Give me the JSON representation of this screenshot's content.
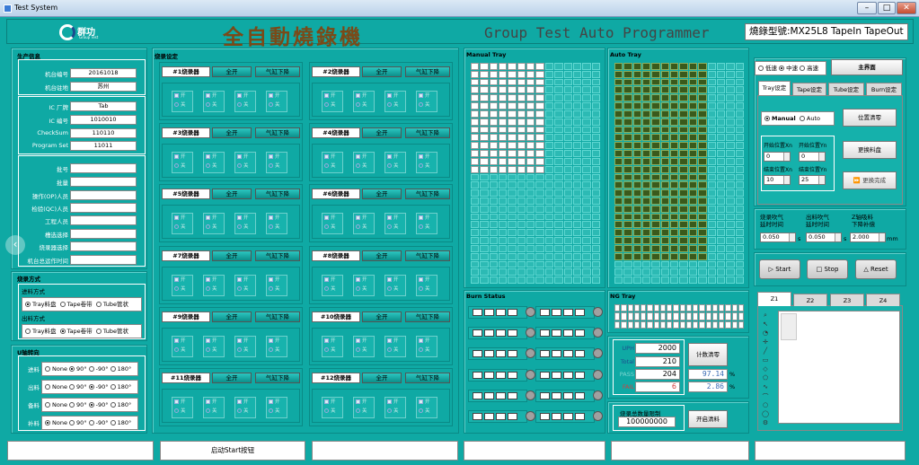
{
  "window": {
    "title": "Test System",
    "minimize": "–",
    "maximize": "□",
    "close": "✕"
  },
  "header": {
    "logo_cn": "群功",
    "logo_en": "Group Test",
    "title_cn": "全自動燒錄機",
    "title_en": "Group Test Auto Programmer",
    "model_text": "燒錄型號:MX25L8 TapeIn TapeOut"
  },
  "info": {
    "title": "生产信息",
    "rows": [
      {
        "label": "机台编号",
        "value": "20161018"
      },
      {
        "label": "机台驻地",
        "value": "苏州"
      },
      {
        "label": "IC 厂牌",
        "value": "Tab"
      },
      {
        "label": "IC 编号",
        "value": "1010010"
      },
      {
        "label": "CheckSum",
        "value": "110110"
      },
      {
        "label": "Program Set",
        "value": "11011"
      },
      {
        "label": "批号",
        "value": ""
      },
      {
        "label": "批量",
        "value": ""
      },
      {
        "label": "操作(OP)人员",
        "value": ""
      },
      {
        "label": "检验(QC)人员",
        "value": ""
      },
      {
        "label": "工程人员",
        "value": ""
      },
      {
        "label": "槽选选择",
        "value": ""
      },
      {
        "label": "烧录器选择",
        "value": ""
      },
      {
        "label": "机台总运作时间",
        "value": ""
      }
    ]
  },
  "burn_mode": {
    "title": "烧录方式",
    "in_label": "进料方式",
    "out_label": "出料方式",
    "opts": [
      "Tray料盘",
      "Tape卷带",
      "Tube管状"
    ]
  },
  "u_axis": {
    "title": "U轴转向",
    "rows": [
      {
        "label": "进料",
        "sel": 1
      },
      {
        "label": "出料",
        "sel": 2
      },
      {
        "label": "备料",
        "sel": 2
      },
      {
        "label": "补料",
        "sel": 0
      }
    ],
    "opts": [
      "None",
      "90°",
      "-90°",
      "180°"
    ]
  },
  "programmers": {
    "title": "烧录设定",
    "all_open": "全开",
    "cylinder": "气缸下降",
    "on": "开",
    "off": "关",
    "items": [
      "#1烧录器",
      "#2烧录器",
      "#3烧录器",
      "#4烧录器",
      "#5烧录器",
      "#6烧录器",
      "#7烧录器",
      "#8烧录器",
      "#9烧录器",
      "#10烧录器",
      "#11烧录器",
      "#12烧录器"
    ]
  },
  "manual_tray": {
    "title": "Manual Tray"
  },
  "auto_tray": {
    "title": "Auto Tray"
  },
  "burn_status": {
    "title": "Burn Status"
  },
  "ng_tray": {
    "title": "NG Tray"
  },
  "counts": {
    "uph_label": "UPH",
    "uph": "2000",
    "total_label": "Total",
    "total": "210",
    "pass_label": "PASS",
    "pass": "204",
    "pass_pct": "97.14",
    "fail_label": "FAIL",
    "fail": "6",
    "fail_pct": "2.86",
    "pct_unit": "%",
    "clear_btn": "计数清零",
    "limit_label": "烧录总数量限制",
    "limit_value": "100000000",
    "clear_material": "开启清料"
  },
  "speed": {
    "opts": [
      "低速",
      "中速",
      "高速"
    ],
    "selected": 1,
    "home_btn": "主界面"
  },
  "tabs": [
    "Tray设定",
    "Tape设定",
    "Tube设定",
    "Burn设定"
  ],
  "tray_settings": {
    "manual": "Manual",
    "auto": "Auto",
    "pos_reset": "位置清零",
    "start_x": "开始位置Xn",
    "start_y": "开始位置Yn",
    "start_x_val": "0",
    "start_y_val": "0",
    "end_x": "结束位置Xn",
    "end_y": "结束位置Yn",
    "end_x_val": "10",
    "end_y_val": "25",
    "change_tray": "更换料盘",
    "change_done": "更换完成"
  },
  "delays": {
    "burn_blow": "烧录吹气\n延时时间",
    "out_blow": "出料吹气\n延时时间",
    "z_comp": "Z轴吸料\n下降补偿",
    "burn_val": "0.050",
    "out_val": "0.050",
    "z_val": "2.000",
    "unit_s": "s",
    "unit_mm": "mm"
  },
  "controls": {
    "start": "Start",
    "stop": "Stop",
    "reset": "Reset"
  },
  "zones": [
    "Z1",
    "Z2",
    "Z3",
    "Z4"
  ],
  "status_bar": {
    "msg": "启动Start按钮"
  },
  "colors": {
    "bg": "#0fa9a4",
    "accent_dark": "#0a8a86",
    "title_brown": "#7a4a18"
  }
}
